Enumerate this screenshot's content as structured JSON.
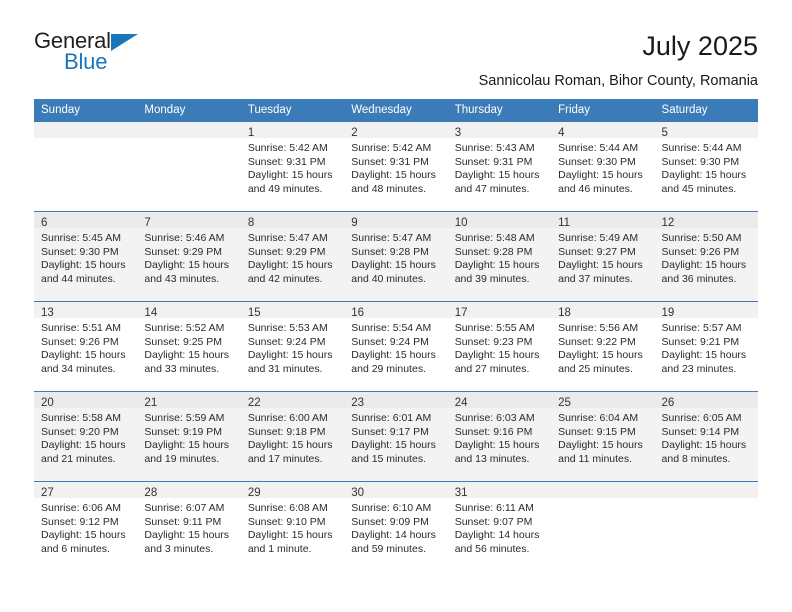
{
  "brand": {
    "name_top": "General",
    "name_bottom": "Blue",
    "accent_color": "#1b75bb"
  },
  "header": {
    "month_title": "July 2025",
    "location": "Sannicolau Roman, Bihor County, Romania"
  },
  "calendar": {
    "header_bg": "#3b7cb8",
    "weekday_headers": [
      "Sunday",
      "Monday",
      "Tuesday",
      "Wednesday",
      "Thursday",
      "Friday",
      "Saturday"
    ],
    "weeks": [
      {
        "shaded": false,
        "days": [
          {
            "day": "",
            "sunrise": "",
            "sunset": "",
            "daylight": ""
          },
          {
            "day": "",
            "sunrise": "",
            "sunset": "",
            "daylight": ""
          },
          {
            "day": "1",
            "sunrise": "Sunrise: 5:42 AM",
            "sunset": "Sunset: 9:31 PM",
            "daylight": "Daylight: 15 hours and 49 minutes."
          },
          {
            "day": "2",
            "sunrise": "Sunrise: 5:42 AM",
            "sunset": "Sunset: 9:31 PM",
            "daylight": "Daylight: 15 hours and 48 minutes."
          },
          {
            "day": "3",
            "sunrise": "Sunrise: 5:43 AM",
            "sunset": "Sunset: 9:31 PM",
            "daylight": "Daylight: 15 hours and 47 minutes."
          },
          {
            "day": "4",
            "sunrise": "Sunrise: 5:44 AM",
            "sunset": "Sunset: 9:30 PM",
            "daylight": "Daylight: 15 hours and 46 minutes."
          },
          {
            "day": "5",
            "sunrise": "Sunrise: 5:44 AM",
            "sunset": "Sunset: 9:30 PM",
            "daylight": "Daylight: 15 hours and 45 minutes."
          }
        ]
      },
      {
        "shaded": true,
        "days": [
          {
            "day": "6",
            "sunrise": "Sunrise: 5:45 AM",
            "sunset": "Sunset: 9:30 PM",
            "daylight": "Daylight: 15 hours and 44 minutes."
          },
          {
            "day": "7",
            "sunrise": "Sunrise: 5:46 AM",
            "sunset": "Sunset: 9:29 PM",
            "daylight": "Daylight: 15 hours and 43 minutes."
          },
          {
            "day": "8",
            "sunrise": "Sunrise: 5:47 AM",
            "sunset": "Sunset: 9:29 PM",
            "daylight": "Daylight: 15 hours and 42 minutes."
          },
          {
            "day": "9",
            "sunrise": "Sunrise: 5:47 AM",
            "sunset": "Sunset: 9:28 PM",
            "daylight": "Daylight: 15 hours and 40 minutes."
          },
          {
            "day": "10",
            "sunrise": "Sunrise: 5:48 AM",
            "sunset": "Sunset: 9:28 PM",
            "daylight": "Daylight: 15 hours and 39 minutes."
          },
          {
            "day": "11",
            "sunrise": "Sunrise: 5:49 AM",
            "sunset": "Sunset: 9:27 PM",
            "daylight": "Daylight: 15 hours and 37 minutes."
          },
          {
            "day": "12",
            "sunrise": "Sunrise: 5:50 AM",
            "sunset": "Sunset: 9:26 PM",
            "daylight": "Daylight: 15 hours and 36 minutes."
          }
        ]
      },
      {
        "shaded": false,
        "days": [
          {
            "day": "13",
            "sunrise": "Sunrise: 5:51 AM",
            "sunset": "Sunset: 9:26 PM",
            "daylight": "Daylight: 15 hours and 34 minutes."
          },
          {
            "day": "14",
            "sunrise": "Sunrise: 5:52 AM",
            "sunset": "Sunset: 9:25 PM",
            "daylight": "Daylight: 15 hours and 33 minutes."
          },
          {
            "day": "15",
            "sunrise": "Sunrise: 5:53 AM",
            "sunset": "Sunset: 9:24 PM",
            "daylight": "Daylight: 15 hours and 31 minutes."
          },
          {
            "day": "16",
            "sunrise": "Sunrise: 5:54 AM",
            "sunset": "Sunset: 9:24 PM",
            "daylight": "Daylight: 15 hours and 29 minutes."
          },
          {
            "day": "17",
            "sunrise": "Sunrise: 5:55 AM",
            "sunset": "Sunset: 9:23 PM",
            "daylight": "Daylight: 15 hours and 27 minutes."
          },
          {
            "day": "18",
            "sunrise": "Sunrise: 5:56 AM",
            "sunset": "Sunset: 9:22 PM",
            "daylight": "Daylight: 15 hours and 25 minutes."
          },
          {
            "day": "19",
            "sunrise": "Sunrise: 5:57 AM",
            "sunset": "Sunset: 9:21 PM",
            "daylight": "Daylight: 15 hours and 23 minutes."
          }
        ]
      },
      {
        "shaded": true,
        "days": [
          {
            "day": "20",
            "sunrise": "Sunrise: 5:58 AM",
            "sunset": "Sunset: 9:20 PM",
            "daylight": "Daylight: 15 hours and 21 minutes."
          },
          {
            "day": "21",
            "sunrise": "Sunrise: 5:59 AM",
            "sunset": "Sunset: 9:19 PM",
            "daylight": "Daylight: 15 hours and 19 minutes."
          },
          {
            "day": "22",
            "sunrise": "Sunrise: 6:00 AM",
            "sunset": "Sunset: 9:18 PM",
            "daylight": "Daylight: 15 hours and 17 minutes."
          },
          {
            "day": "23",
            "sunrise": "Sunrise: 6:01 AM",
            "sunset": "Sunset: 9:17 PM",
            "daylight": "Daylight: 15 hours and 15 minutes."
          },
          {
            "day": "24",
            "sunrise": "Sunrise: 6:03 AM",
            "sunset": "Sunset: 9:16 PM",
            "daylight": "Daylight: 15 hours and 13 minutes."
          },
          {
            "day": "25",
            "sunrise": "Sunrise: 6:04 AM",
            "sunset": "Sunset: 9:15 PM",
            "daylight": "Daylight: 15 hours and 11 minutes."
          },
          {
            "day": "26",
            "sunrise": "Sunrise: 6:05 AM",
            "sunset": "Sunset: 9:14 PM",
            "daylight": "Daylight: 15 hours and 8 minutes."
          }
        ]
      },
      {
        "shaded": false,
        "days": [
          {
            "day": "27",
            "sunrise": "Sunrise: 6:06 AM",
            "sunset": "Sunset: 9:12 PM",
            "daylight": "Daylight: 15 hours and 6 minutes."
          },
          {
            "day": "28",
            "sunrise": "Sunrise: 6:07 AM",
            "sunset": "Sunset: 9:11 PM",
            "daylight": "Daylight: 15 hours and 3 minutes."
          },
          {
            "day": "29",
            "sunrise": "Sunrise: 6:08 AM",
            "sunset": "Sunset: 9:10 PM",
            "daylight": "Daylight: 15 hours and 1 minute."
          },
          {
            "day": "30",
            "sunrise": "Sunrise: 6:10 AM",
            "sunset": "Sunset: 9:09 PM",
            "daylight": "Daylight: 14 hours and 59 minutes."
          },
          {
            "day": "31",
            "sunrise": "Sunrise: 6:11 AM",
            "sunset": "Sunset: 9:07 PM",
            "daylight": "Daylight: 14 hours and 56 minutes."
          },
          {
            "day": "",
            "sunrise": "",
            "sunset": "",
            "daylight": ""
          },
          {
            "day": "",
            "sunrise": "",
            "sunset": "",
            "daylight": ""
          }
        ]
      }
    ]
  }
}
